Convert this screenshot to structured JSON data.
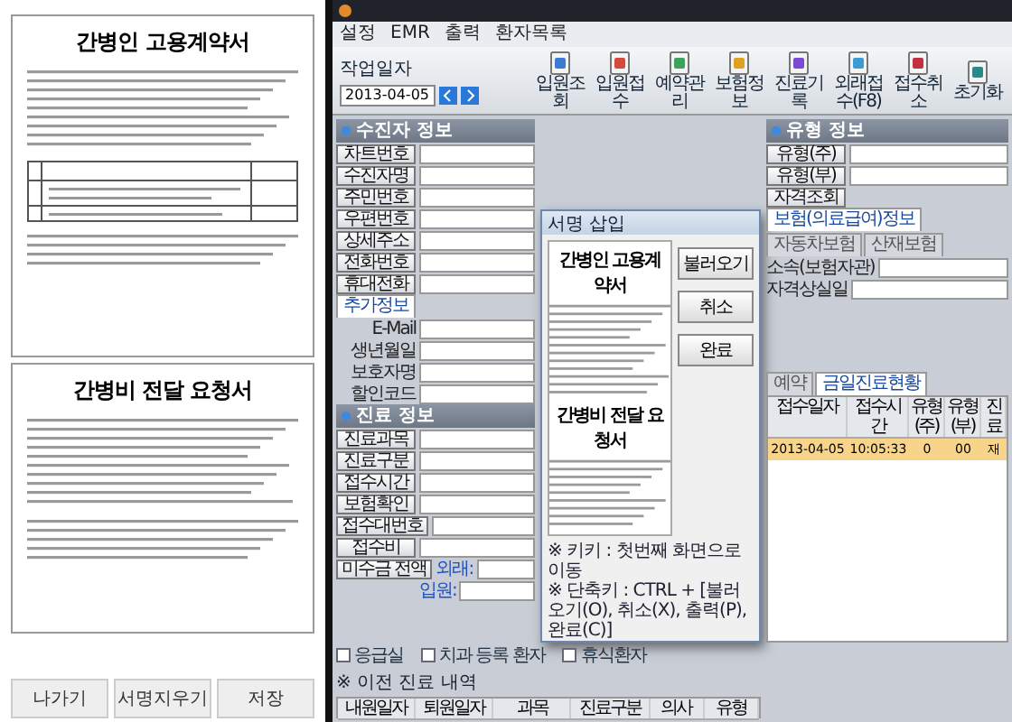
{
  "document": {
    "sheets": [
      {
        "title": "간병인 고용계약서"
      },
      {
        "title": "간병비 전달 요청서"
      }
    ],
    "buttons": [
      "나가기",
      "서명지우기",
      "저장"
    ]
  },
  "window": {
    "menu": [
      "설정",
      "EMR",
      "출력",
      "환자목록"
    ]
  },
  "toolbar": {
    "date_label": "작업일자",
    "date": "2013-04-05",
    "items": [
      "입원조회",
      "입원접수",
      "예약관리",
      "보험정보",
      "진료기록",
      "외래접수(F8)",
      "접수취소",
      "초기화"
    ]
  },
  "patient": {
    "title": "수진자 정보",
    "fields": [
      "차트번호",
      "수진자명",
      "주민번호",
      "우편번호",
      "상세주소",
      "전화번호",
      "휴대전화"
    ],
    "tabs": [
      {
        "label": "추가정보",
        "selected": true
      }
    ],
    "extra_fields": [
      "E-Mail",
      "생년월일",
      "보호자명",
      "할인코드"
    ]
  },
  "visit": {
    "title": "진료 정보",
    "fields": [
      "진료과목",
      "진료구분",
      "접수시간",
      "보험확인",
      "접수대번호",
      "접수비"
    ],
    "balance": {
      "label": "미수금 전액",
      "outpatient": "외래:",
      "inpatient": "입원:"
    },
    "checks": [
      {
        "label": "응급실",
        "checked": false
      },
      {
        "label": "치과 등록 환자",
        "checked": false
      },
      {
        "label": "휴식환자",
        "checked": false
      }
    ]
  },
  "history": {
    "title": "※ 이전 진료 내역",
    "columns": [
      "내원일자",
      "퇴원일자",
      "과목",
      "진료구분",
      "의사",
      "유형"
    ]
  },
  "insurance": {
    "title": "유형 정보",
    "fields": [
      "유형(주)",
      "유형(부)"
    ],
    "lookup_button": "자격조회",
    "tabs": [
      {
        "label": "보험(의료급여)정보",
        "selected": true
      },
      {
        "label": "자동차보험",
        "selected": false
      },
      {
        "label": "산재보험",
        "selected": false
      }
    ],
    "more_fields": [
      "소속(보험자관)",
      "자격상실일"
    ]
  },
  "today": {
    "tabs": [
      {
        "label": "예약",
        "selected": false
      },
      {
        "label": "금일진료현황",
        "selected": true
      }
    ],
    "columns": [
      "접수일자",
      "접수시간",
      "유형(주)",
      "유형(부)",
      "진료"
    ],
    "rows": [
      {
        "cells": [
          "2013-04-05",
          "10:05:33",
          "0",
          "00",
          "재"
        ],
        "selected": true
      }
    ]
  },
  "dialog": {
    "title": "서명 삽입",
    "preview_titles": [
      "간병인 고용계약서",
      "간병비 전달 요청서"
    ],
    "buttons": [
      "불러오기",
      "취소",
      "완료"
    ],
    "notes": [
      "※ 키키 : 첫번째 화면으로 이동",
      "※ 단축키 : CTRL + [불러오기(O), 취소(X), 출력(P), 완료(C)]"
    ]
  }
}
